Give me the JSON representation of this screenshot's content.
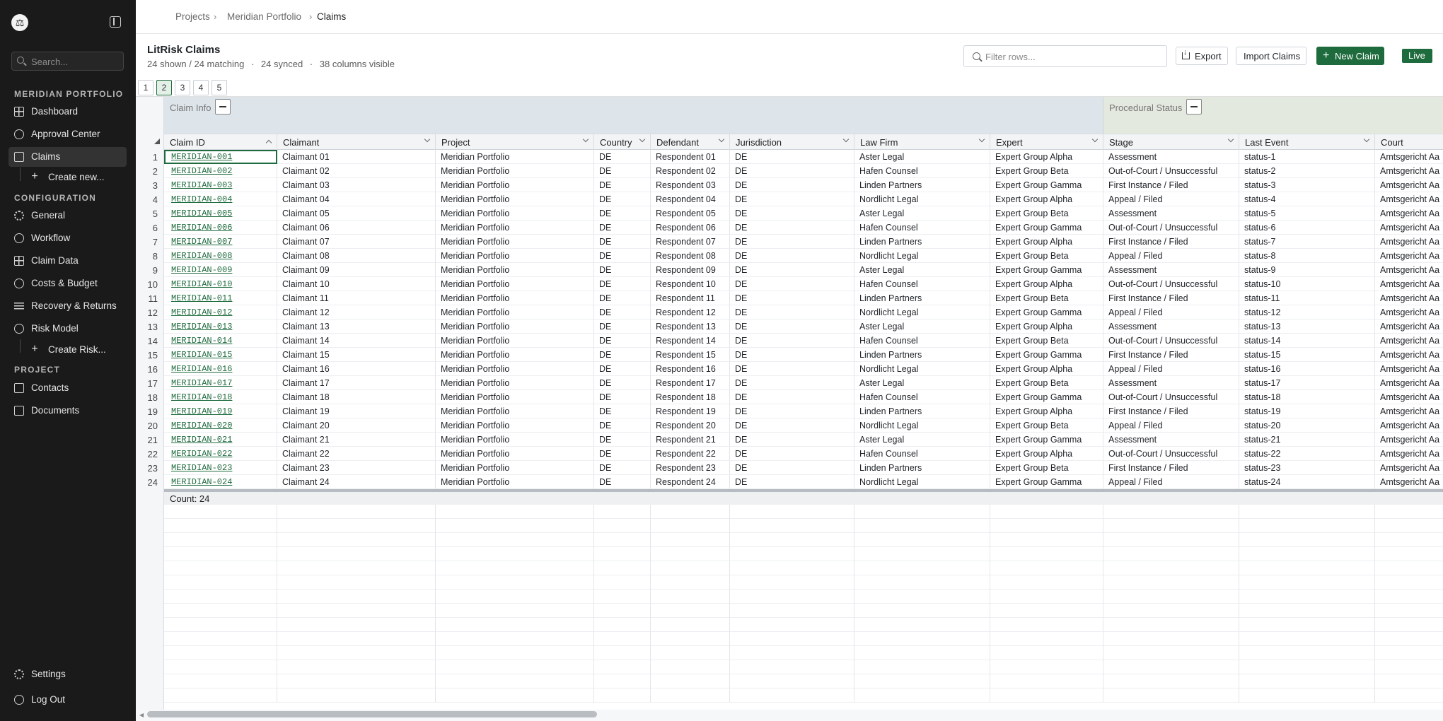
{
  "sidebar": {
    "logo_glyph": "⚖",
    "search_placeholder": "Search...",
    "section_portfolio": "MERIDIAN PORTFOLIO",
    "section_config": "CONFIGURATION",
    "section_project": "PROJECT",
    "items": {
      "dashboard": "Dashboard",
      "approval": "Approval Center",
      "claims": "Claims",
      "create_new": "Create new...",
      "general": "General",
      "workflow": "Workflow",
      "claim_data": "Claim Data",
      "costs": "Costs & Budget",
      "recovery": "Recovery & Returns",
      "risk_model": "Risk Model",
      "create_risk": "Create Risk...",
      "contacts": "Contacts",
      "documents": "Documents",
      "settings": "Settings",
      "logout": "Log Out"
    }
  },
  "breadcrumb": {
    "projects": "Projects",
    "portfolio": "Meridian Portfolio",
    "current": "Claims"
  },
  "header": {
    "title": "LitRisk Claims",
    "shown": "24 shown / 24 matching",
    "synced": "24 synced",
    "columns": "38 columns visible",
    "sep": "·",
    "filter_placeholder": "Filter rows...",
    "export": "Export",
    "import": "Import Claims",
    "new_claim": "New Claim",
    "live": "Live"
  },
  "pager": [
    "1",
    "2",
    "3",
    "4",
    "5"
  ],
  "groups": {
    "claim_info": "Claim Info",
    "procedural": "Procedural Status"
  },
  "columns": [
    "Claim ID",
    "Claimant",
    "Project",
    "Country",
    "Defendant",
    "Jurisdiction",
    "Law Firm",
    "Expert",
    "Stage",
    "Last Event",
    "Court"
  ],
  "rows": [
    [
      "1",
      "MERIDIAN-001",
      "Claimant 01",
      "Meridian Portfolio",
      "DE",
      "Respondent 01",
      "DE",
      "Aster Legal",
      "Expert Group Alpha",
      "Assessment",
      "status-1",
      "Amtsgericht Aa"
    ],
    [
      "2",
      "MERIDIAN-002",
      "Claimant 02",
      "Meridian Portfolio",
      "DE",
      "Respondent 02",
      "DE",
      "Hafen Counsel",
      "Expert Group Beta",
      "Out-of-Court / Unsuccessful",
      "status-2",
      "Amtsgericht Aa"
    ],
    [
      "3",
      "MERIDIAN-003",
      "Claimant 03",
      "Meridian Portfolio",
      "DE",
      "Respondent 03",
      "DE",
      "Linden Partners",
      "Expert Group Gamma",
      "First Instance / Filed",
      "status-3",
      "Amtsgericht Aa"
    ],
    [
      "4",
      "MERIDIAN-004",
      "Claimant 04",
      "Meridian Portfolio",
      "DE",
      "Respondent 04",
      "DE",
      "Nordlicht Legal",
      "Expert Group Alpha",
      "Appeal / Filed",
      "status-4",
      "Amtsgericht Aa"
    ],
    [
      "5",
      "MERIDIAN-005",
      "Claimant 05",
      "Meridian Portfolio",
      "DE",
      "Respondent 05",
      "DE",
      "Aster Legal",
      "Expert Group Beta",
      "Assessment",
      "status-5",
      "Amtsgericht Aa"
    ],
    [
      "6",
      "MERIDIAN-006",
      "Claimant 06",
      "Meridian Portfolio",
      "DE",
      "Respondent 06",
      "DE",
      "Hafen Counsel",
      "Expert Group Gamma",
      "Out-of-Court / Unsuccessful",
      "status-6",
      "Amtsgericht Aa"
    ],
    [
      "7",
      "MERIDIAN-007",
      "Claimant 07",
      "Meridian Portfolio",
      "DE",
      "Respondent 07",
      "DE",
      "Linden Partners",
      "Expert Group Alpha",
      "First Instance / Filed",
      "status-7",
      "Amtsgericht Aa"
    ],
    [
      "8",
      "MERIDIAN-008",
      "Claimant 08",
      "Meridian Portfolio",
      "DE",
      "Respondent 08",
      "DE",
      "Nordlicht Legal",
      "Expert Group Beta",
      "Appeal / Filed",
      "status-8",
      "Amtsgericht Aa"
    ],
    [
      "9",
      "MERIDIAN-009",
      "Claimant 09",
      "Meridian Portfolio",
      "DE",
      "Respondent 09",
      "DE",
      "Aster Legal",
      "Expert Group Gamma",
      "Assessment",
      "status-9",
      "Amtsgericht Aa"
    ],
    [
      "10",
      "MERIDIAN-010",
      "Claimant 10",
      "Meridian Portfolio",
      "DE",
      "Respondent 10",
      "DE",
      "Hafen Counsel",
      "Expert Group Alpha",
      "Out-of-Court / Unsuccessful",
      "status-10",
      "Amtsgericht Aa"
    ],
    [
      "11",
      "MERIDIAN-011",
      "Claimant 11",
      "Meridian Portfolio",
      "DE",
      "Respondent 11",
      "DE",
      "Linden Partners",
      "Expert Group Beta",
      "First Instance / Filed",
      "status-11",
      "Amtsgericht Aa"
    ],
    [
      "12",
      "MERIDIAN-012",
      "Claimant 12",
      "Meridian Portfolio",
      "DE",
      "Respondent 12",
      "DE",
      "Nordlicht Legal",
      "Expert Group Gamma",
      "Appeal / Filed",
      "status-12",
      "Amtsgericht Aa"
    ],
    [
      "13",
      "MERIDIAN-013",
      "Claimant 13",
      "Meridian Portfolio",
      "DE",
      "Respondent 13",
      "DE",
      "Aster Legal",
      "Expert Group Alpha",
      "Assessment",
      "status-13",
      "Amtsgericht Aa"
    ],
    [
      "14",
      "MERIDIAN-014",
      "Claimant 14",
      "Meridian Portfolio",
      "DE",
      "Respondent 14",
      "DE",
      "Hafen Counsel",
      "Expert Group Beta",
      "Out-of-Court / Unsuccessful",
      "status-14",
      "Amtsgericht Aa"
    ],
    [
      "15",
      "MERIDIAN-015",
      "Claimant 15",
      "Meridian Portfolio",
      "DE",
      "Respondent 15",
      "DE",
      "Linden Partners",
      "Expert Group Gamma",
      "First Instance / Filed",
      "status-15",
      "Amtsgericht Aa"
    ],
    [
      "16",
      "MERIDIAN-016",
      "Claimant 16",
      "Meridian Portfolio",
      "DE",
      "Respondent 16",
      "DE",
      "Nordlicht Legal",
      "Expert Group Alpha",
      "Appeal / Filed",
      "status-16",
      "Amtsgericht Aa"
    ],
    [
      "17",
      "MERIDIAN-017",
      "Claimant 17",
      "Meridian Portfolio",
      "DE",
      "Respondent 17",
      "DE",
      "Aster Legal",
      "Expert Group Beta",
      "Assessment",
      "status-17",
      "Amtsgericht Aa"
    ],
    [
      "18",
      "MERIDIAN-018",
      "Claimant 18",
      "Meridian Portfolio",
      "DE",
      "Respondent 18",
      "DE",
      "Hafen Counsel",
      "Expert Group Gamma",
      "Out-of-Court / Unsuccessful",
      "status-18",
      "Amtsgericht Aa"
    ],
    [
      "19",
      "MERIDIAN-019",
      "Claimant 19",
      "Meridian Portfolio",
      "DE",
      "Respondent 19",
      "DE",
      "Linden Partners",
      "Expert Group Alpha",
      "First Instance / Filed",
      "status-19",
      "Amtsgericht Aa"
    ],
    [
      "20",
      "MERIDIAN-020",
      "Claimant 20",
      "Meridian Portfolio",
      "DE",
      "Respondent 20",
      "DE",
      "Nordlicht Legal",
      "Expert Group Beta",
      "Appeal / Filed",
      "status-20",
      "Amtsgericht Aa"
    ],
    [
      "21",
      "MERIDIAN-021",
      "Claimant 21",
      "Meridian Portfolio",
      "DE",
      "Respondent 21",
      "DE",
      "Aster Legal",
      "Expert Group Gamma",
      "Assessment",
      "status-21",
      "Amtsgericht Aa"
    ],
    [
      "22",
      "MERIDIAN-022",
      "Claimant 22",
      "Meridian Portfolio",
      "DE",
      "Respondent 22",
      "DE",
      "Hafen Counsel",
      "Expert Group Alpha",
      "Out-of-Court / Unsuccessful",
      "status-22",
      "Amtsgericht Aa"
    ],
    [
      "23",
      "MERIDIAN-023",
      "Claimant 23",
      "Meridian Portfolio",
      "DE",
      "Respondent 23",
      "DE",
      "Linden Partners",
      "Expert Group Beta",
      "First Instance / Filed",
      "status-23",
      "Amtsgericht Aa"
    ],
    [
      "24",
      "MERIDIAN-024",
      "Claimant 24",
      "Meridian Portfolio",
      "DE",
      "Respondent 24",
      "DE",
      "Nordlicht Legal",
      "Expert Group Gamma",
      "Appeal / Filed",
      "status-24",
      "Amtsgericht Aa"
    ]
  ],
  "summary": {
    "count": "Count: 24"
  },
  "colors": {
    "accent": "#1e6b3d",
    "sidebar_bg": "#1a1a1a",
    "group_claim_info": "#dde4ea",
    "group_procedural": "#e3e9df"
  }
}
